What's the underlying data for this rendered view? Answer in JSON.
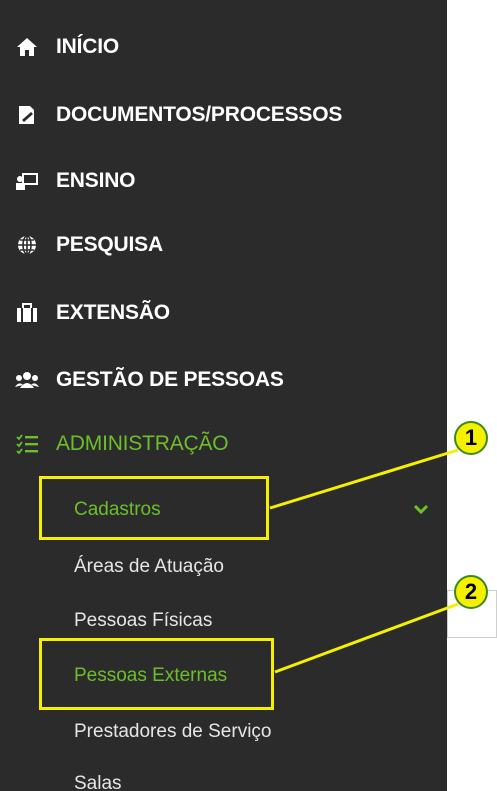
{
  "menu": [
    {
      "label": "INÍCIO",
      "icon": "home-icon"
    },
    {
      "label": "DOCUMENTOS/PROCESSOS",
      "icon": "document-edit-icon"
    },
    {
      "label": "ENSINO",
      "icon": "teaching-board-icon"
    },
    {
      "label": "PESQUISA",
      "icon": "globe-icon"
    },
    {
      "label": "EXTENSÃO",
      "icon": "briefcase-icon"
    },
    {
      "label": "GESTÃO DE PESSOAS",
      "icon": "users-icon"
    },
    {
      "label": "ADMINISTRAÇÃO",
      "icon": "list-check-icon"
    }
  ],
  "submenu": {
    "section_label": "Cadastros",
    "items": [
      "Áreas de Atuação",
      "Pessoas Físicas",
      "Pessoas Externas",
      "Prestadores de Serviço",
      "Salas"
    ]
  },
  "annotations": [
    "1",
    "2"
  ],
  "colors": {
    "sidebar_bg": "#2b2b2b",
    "accent_green": "#6cbf2b",
    "highlight_yellow": "#f4f000"
  }
}
